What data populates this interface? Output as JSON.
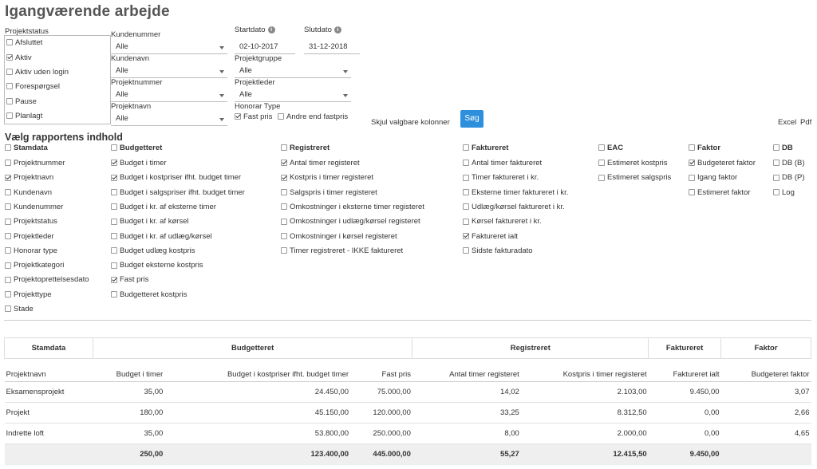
{
  "page_title": "Igangværende arbejde",
  "filters": {
    "projektstatus_label": "Projektstatus",
    "projektstatus": [
      {
        "label": "Afsluttet",
        "checked": false
      },
      {
        "label": "Aktiv",
        "checked": true
      },
      {
        "label": "Aktiv uden login",
        "checked": false
      },
      {
        "label": "Forespørgsel",
        "checked": false
      },
      {
        "label": "Pause",
        "checked": false
      },
      {
        "label": "Planlagt",
        "checked": false
      }
    ],
    "kundenummer": {
      "label": "Kundenummer",
      "value": "Alle"
    },
    "kundenavn": {
      "label": "Kundenavn",
      "value": "Alle"
    },
    "projektnummer": {
      "label": "Projektnummer",
      "value": "Alle"
    },
    "projektnavn": {
      "label": "Projektnavn",
      "value": "Alle"
    },
    "startdato": {
      "label": "Startdato",
      "value": "02-10-2017"
    },
    "slutdato": {
      "label": "Slutdato",
      "value": "31-12-2018"
    },
    "projektgruppe": {
      "label": "Projektgruppe",
      "value": "Alle"
    },
    "projektleder": {
      "label": "Projektleder",
      "value": "Alle"
    },
    "honorar_type": {
      "label": "Honorar Type",
      "fast_pris": {
        "label": "Fast pris",
        "checked": true
      },
      "andre": {
        "label": "Andre end fastpris",
        "checked": false
      }
    }
  },
  "toolbar": {
    "hide_columns": "Skjul valgbare kolonner",
    "search_button": "Søg",
    "excel": "Excel",
    "pdf": "Pdf"
  },
  "report_section_title": "Vælg rapportens indhold",
  "report_columns": [
    {
      "head": "Stamdata",
      "items": [
        {
          "label": "Projektnummer",
          "checked": false
        },
        {
          "label": "Projektnavn",
          "checked": true
        },
        {
          "label": "Kundenavn",
          "checked": false
        },
        {
          "label": "Kundenummer",
          "checked": false
        },
        {
          "label": "Projektstatus",
          "checked": false
        },
        {
          "label": "Projektleder",
          "checked": false
        },
        {
          "label": "Honorar type",
          "checked": false
        },
        {
          "label": "Projektkategori",
          "checked": false
        },
        {
          "label": "Projektoprettelsesdato",
          "checked": false
        },
        {
          "label": "Projekttype",
          "checked": false
        },
        {
          "label": "Stade",
          "checked": false
        }
      ]
    },
    {
      "head": "Budgetteret",
      "items": [
        {
          "label": "Budget i timer",
          "checked": true
        },
        {
          "label": "Budget i kostpriser ifht. budget timer",
          "checked": true
        },
        {
          "label": "Budget i salgspriser ifht. budget timer",
          "checked": false
        },
        {
          "label": "Budget i kr. af eksterne timer",
          "checked": false
        },
        {
          "label": "Budget i kr. af kørsel",
          "checked": false
        },
        {
          "label": "Budget i kr. af udlæg/kørsel",
          "checked": false
        },
        {
          "label": "Budget udlæg kostpris",
          "checked": false
        },
        {
          "label": "Budget eksterne kostpris",
          "checked": false
        },
        {
          "label": "Fast pris",
          "checked": true
        },
        {
          "label": "Budgetteret kostpris",
          "checked": false
        }
      ]
    },
    {
      "head": "Registreret",
      "items": [
        {
          "label": "Antal timer registeret",
          "checked": true
        },
        {
          "label": "Kostpris i timer registeret",
          "checked": true
        },
        {
          "label": "Salgspris i timer registeret",
          "checked": false
        },
        {
          "label": "Omkostninger i eksterne timer registeret",
          "checked": false
        },
        {
          "label": "Omkostninger i udlæg/kørsel registeret",
          "checked": false
        },
        {
          "label": "Omkostninger i kørsel registeret",
          "checked": false
        },
        {
          "label": "Timer registreret - IKKE faktureret",
          "checked": false
        }
      ]
    },
    {
      "head": "Faktureret",
      "items": [
        {
          "label": "Antal timer faktureret",
          "checked": false
        },
        {
          "label": "Timer faktureret i kr.",
          "checked": false
        },
        {
          "label": "Eksterne timer faktureret i kr.",
          "checked": false
        },
        {
          "label": "Udlæg/kørsel faktureret i kr.",
          "checked": false
        },
        {
          "label": "Kørsel faktureret i kr.",
          "checked": false
        },
        {
          "label": "Faktureret ialt",
          "checked": true
        },
        {
          "label": "Sidste fakturadato",
          "checked": false
        }
      ]
    },
    {
      "head": "EAC",
      "items": [
        {
          "label": "Estimeret kostpris",
          "checked": false
        },
        {
          "label": "Estimeret salgspris",
          "checked": false
        }
      ]
    },
    {
      "head": "Faktor",
      "items": [
        {
          "label": "Budgeteret faktor",
          "checked": true
        },
        {
          "label": "Igang faktor",
          "checked": false
        },
        {
          "label": "Estimeret faktor",
          "checked": false
        }
      ]
    },
    {
      "head": "DB",
      "items": [
        {
          "label": "DB (B)",
          "checked": false
        },
        {
          "label": "DB (P)",
          "checked": false
        },
        {
          "label": "Log",
          "checked": false
        }
      ]
    }
  ],
  "table": {
    "groups": [
      "Stamdata",
      "Budgetteret",
      "Registreret",
      "Faktureret",
      "Faktor"
    ],
    "columns": [
      "Projektnavn",
      "Budget i timer",
      "Budget i kostpriser ifht. budget timer",
      "Fast pris",
      "Antal timer registeret",
      "Kostpris i timer registeret",
      "Faktureret ialt",
      "Budgeteret faktor"
    ],
    "rows": [
      [
        "Eksamensprojekt",
        "35,00",
        "24.450,00",
        "75.000,00",
        "14,02",
        "2.103,00",
        "9.450,00",
        "3,07"
      ],
      [
        "Projekt",
        "180,00",
        "45.150,00",
        "120.000,00",
        "33,25",
        "8.312,50",
        "0,00",
        "2,66"
      ],
      [
        "Indrette loft",
        "35,00",
        "53.800,00",
        "250.000,00",
        "8,00",
        "2.000,00",
        "0,00",
        "4,65"
      ]
    ],
    "totals": [
      "",
      "250,00",
      "123.400,00",
      "445.000,00",
      "55,27",
      "12.415,50",
      "9.450,00",
      ""
    ]
  }
}
